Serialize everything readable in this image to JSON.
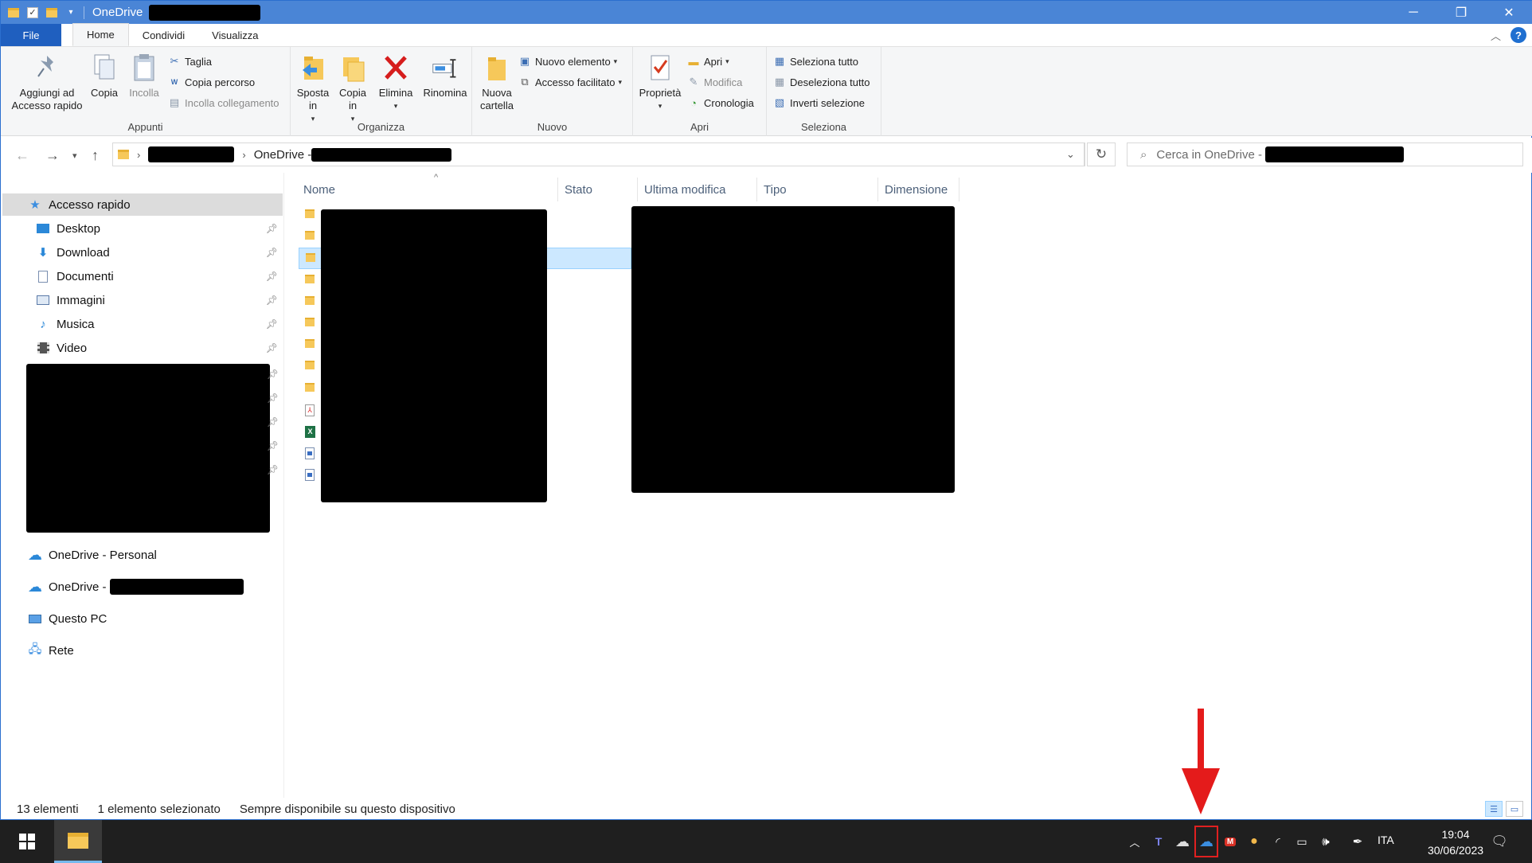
{
  "window": {
    "title": "OneDrive",
    "controls": {
      "minimize": "─",
      "restore": "❐",
      "close": "✕"
    }
  },
  "ribbon_tabs": [
    "File",
    "Home",
    "Condividi",
    "Visualizza"
  ],
  "ribbon": {
    "appunti": {
      "label": "Appunti",
      "pin": "Aggiungi ad\nAccesso rapido",
      "copy": "Copia",
      "paste": "Incolla",
      "cut": "Taglia",
      "copy_path": "Copia percorso",
      "paste_link": "Incolla collegamento"
    },
    "organizza": {
      "label": "Organizza",
      "move_to": "Sposta\nin",
      "copy_to": "Copia\nin",
      "delete": "Elimina",
      "rename": "Rinomina"
    },
    "nuovo": {
      "label": "Nuovo",
      "new_folder": "Nuova\ncartella",
      "new_item": "Nuovo elemento",
      "easy_access": "Accesso facilitato"
    },
    "apri": {
      "label": "Apri",
      "properties": "Proprietà",
      "open": "Apri",
      "edit": "Modifica",
      "history": "Cronologia"
    },
    "seleziona": {
      "label": "Seleziona",
      "select_all": "Seleziona tutto",
      "select_none": "Deseleziona tutto",
      "invert": "Inverti selezione"
    }
  },
  "address": {
    "path_current": "OneDrive -",
    "search_placeholder": "Cerca in OneDrive -"
  },
  "nav": {
    "quick_access": "Accesso rapido",
    "pinned": [
      "Desktop",
      "Download",
      "Documenti",
      "Immagini",
      "Musica",
      "Video"
    ],
    "onedrive_personal": "OneDrive - Personal",
    "onedrive_business": "OneDrive -",
    "this_pc": "Questo PC",
    "network": "Rete"
  },
  "columns": [
    "Nome",
    "Stato",
    "Ultima modifica",
    "Tipo",
    "Dimensione"
  ],
  "files": [
    {
      "type": "folder",
      "selected": false
    },
    {
      "type": "folder",
      "selected": false
    },
    {
      "type": "folder",
      "selected": true
    },
    {
      "type": "folder",
      "selected": false
    },
    {
      "type": "folder",
      "selected": false
    },
    {
      "type": "folder",
      "selected": false
    },
    {
      "type": "folder",
      "selected": false
    },
    {
      "type": "folder",
      "selected": false
    },
    {
      "type": "folder",
      "selected": false
    },
    {
      "type": "pdf",
      "selected": false
    },
    {
      "type": "xlsx",
      "selected": false
    },
    {
      "type": "image",
      "selected": false
    },
    {
      "type": "image",
      "selected": false
    }
  ],
  "status": {
    "count": "13 elementi",
    "selection": "1 elemento selezionato",
    "availability": "Sempre disponibile su questo dispositivo"
  },
  "taskbar": {
    "language": "ITA",
    "time": "19:04",
    "date": "30/06/2023"
  },
  "colors": {
    "titlebar": "#4a85d6",
    "file_tab": "#1f5fbf",
    "selection": "#cce8ff",
    "status_ok": "#2eaa3a",
    "annotation_arrow": "#e41b1b"
  }
}
